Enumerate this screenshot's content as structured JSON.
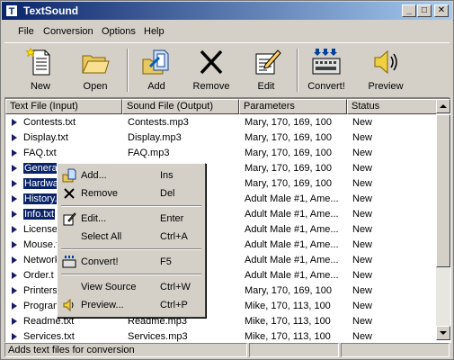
{
  "window": {
    "title": "TextSound",
    "app_icon_letter": "T"
  },
  "menu": [
    "File",
    "Conversion",
    "Options",
    "Help"
  ],
  "toolbar": [
    {
      "label": "New",
      "icon": "new-document-icon"
    },
    {
      "label": "Open",
      "icon": "open-folder-icon"
    },
    {
      "label": "Add",
      "icon": "add-files-icon"
    },
    {
      "label": "Remove",
      "icon": "remove-x-icon"
    },
    {
      "label": "Edit",
      "icon": "edit-icon"
    },
    {
      "label": "Convert!",
      "icon": "convert-icon"
    },
    {
      "label": "Preview",
      "icon": "speaker-icon"
    }
  ],
  "list": {
    "columns": [
      "Text File (Input)",
      "Sound File (Output)",
      "Parameters",
      "Status"
    ],
    "rows": [
      {
        "input": "Contests.txt",
        "output": "Contests.mp3",
        "params": "Mary, 170, 169, 100",
        "status": "New"
      },
      {
        "input": "Display.txt",
        "output": "Display.mp3",
        "params": "Mary, 170, 169, 100",
        "status": "New"
      },
      {
        "input": "FAQ.txt",
        "output": "FAQ.mp3",
        "params": "Mary, 170, 169, 100",
        "status": "New"
      },
      {
        "input": "General",
        "output": "",
        "params": "Mary, 170, 169, 100",
        "status": "New"
      },
      {
        "input": "Hardwa",
        "output": "",
        "params": "Mary, 170, 169, 100",
        "status": "New"
      },
      {
        "input": "History.",
        "output": "",
        "params": "Adult Male #1, Ame...",
        "status": "New"
      },
      {
        "input": "Info.txt",
        "output": "",
        "params": "Adult Male #1, Ame...",
        "status": "New"
      },
      {
        "input": "License.",
        "output": "",
        "params": "Adult Male #1, Ame...",
        "status": "New"
      },
      {
        "input": "Mouse.t",
        "output": "",
        "params": "Adult Male #1, Ame...",
        "status": "New"
      },
      {
        "input": "Network",
        "output": "",
        "params": "Adult Male #1, Ame...",
        "status": "New"
      },
      {
        "input": "Order.t",
        "output": "",
        "params": "Adult Male #1, Ame...",
        "status": "New"
      },
      {
        "input": "Printers",
        "output": "",
        "params": "Mary, 170, 169, 100",
        "status": "New"
      },
      {
        "input": "Program",
        "output": "",
        "params": "Mike, 170, 113, 100",
        "status": "New"
      },
      {
        "input": "Readme.txt",
        "output": "Readme.mp3",
        "params": "Mike, 170, 113, 100",
        "status": "New"
      },
      {
        "input": "Services.txt",
        "output": "Services.mp3",
        "params": "Mike, 170, 113, 100",
        "status": "New"
      }
    ]
  },
  "context_menu": [
    {
      "label": "Add...",
      "key": "Ins",
      "icon": "add-files-icon"
    },
    {
      "label": "Remove",
      "key": "Del",
      "icon": "remove-x-icon"
    },
    {
      "separator": true
    },
    {
      "label": "Edit...",
      "key": "Enter",
      "icon": "edit-icon"
    },
    {
      "label": "Select All",
      "key": "Ctrl+A",
      "icon": ""
    },
    {
      "separator": true
    },
    {
      "label": "Convert!",
      "key": "F5",
      "icon": "convert-icon"
    },
    {
      "separator": true
    },
    {
      "label": "View Source",
      "key": "Ctrl+W",
      "icon": ""
    },
    {
      "label": "Preview...",
      "key": "Ctrl+P",
      "icon": "speaker-icon"
    }
  ],
  "status": {
    "message": "Adds text files for conversion"
  },
  "colors": {
    "title_start": "#0a246a",
    "title_end": "#a6caf0",
    "selection": "#0a246a",
    "face": "#d4d0c8"
  }
}
